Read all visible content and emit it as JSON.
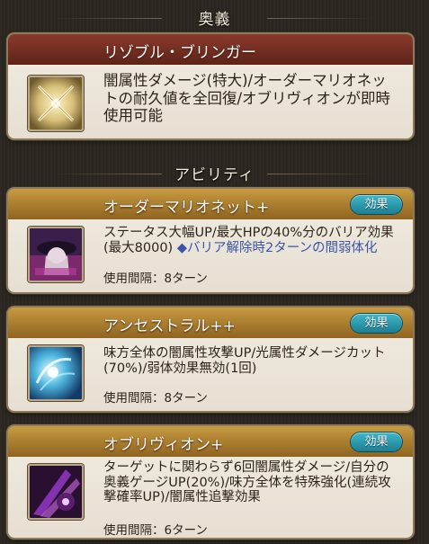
{
  "ougi_section": {
    "header": "奥義",
    "skill": {
      "name": "リゾブル・ブリンガー",
      "description": "闇属性ダメージ(特大)/オーダーマリオネットの耐久値を全回復/オブリヴィオンが即時使用可能",
      "icon": "crossed-swords-icon"
    }
  },
  "ability_section": {
    "header": "アビリティ",
    "effect_button_label": "効果",
    "abilities": [
      {
        "name": "オーダーマリオネット+",
        "description": "ステータス大幅UP/最大HPの40%分のバリア効果(最大8000)",
        "note": "◆バリア解除時2ターンの間弱体化",
        "cooldown": "使用間隔：8ターン",
        "icon": "marionette-portrait-icon"
      },
      {
        "name": "アンセストラル++",
        "description": "味方全体の闇属性攻撃UP/光属性ダメージカット(70%)/弱体効果無効(1回)",
        "cooldown": "使用間隔：8ターン",
        "icon": "blue-energy-icon"
      },
      {
        "name": "オブリヴィオン+",
        "description": "ターゲットに関わらず6回闇属性ダメージ/自分の奥義ゲージUP(20%)/味方全体を特殊強化(連続攻撃確率UP)/闇属性追撃効果",
        "cooldown": "使用間隔：6ターン",
        "icon": "dark-strike-icon"
      }
    ]
  }
}
